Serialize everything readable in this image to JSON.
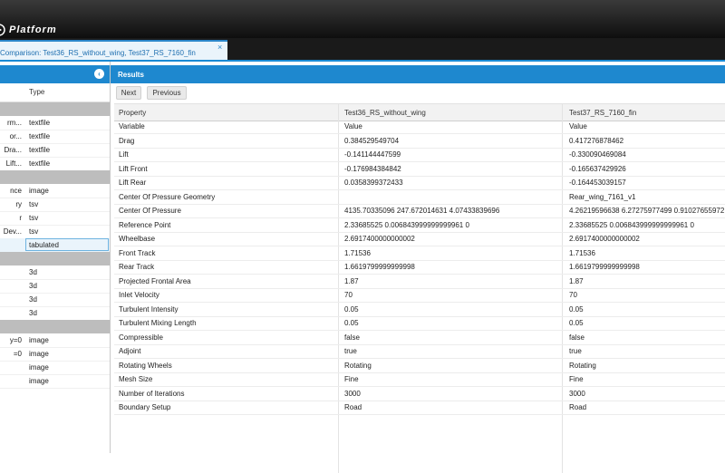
{
  "app": {
    "brand": "Platform"
  },
  "tab": {
    "label": "Comparison: Test36_RS_without_wing, Test37_RS_7160_fin",
    "close": "×"
  },
  "left_panel": {
    "toggle": "‹",
    "columns": [
      "",
      "Type"
    ],
    "groups": [
      {
        "rows": [
          {
            "name": "rm...",
            "type": "textfile"
          },
          {
            "name": "or...",
            "type": "textfile"
          },
          {
            "name": "Dra...",
            "type": "textfile"
          },
          {
            "name": "Lift...",
            "type": "textfile"
          }
        ]
      },
      {
        "rows": [
          {
            "name": "nce",
            "type": "image"
          },
          {
            "name": "ry",
            "type": "tsv"
          },
          {
            "name": "r",
            "type": "tsv"
          },
          {
            "name": "Dev...",
            "type": "tsv"
          },
          {
            "name": "",
            "type": "tabulated",
            "selected": true
          }
        ]
      },
      {
        "rows": [
          {
            "name": "",
            "type": "3d"
          },
          {
            "name": "",
            "type": "3d"
          },
          {
            "name": "",
            "type": "3d"
          },
          {
            "name": "",
            "type": "3d"
          }
        ]
      },
      {
        "rows": [
          {
            "name": "y=0",
            "type": "image"
          },
          {
            "name": "=0",
            "type": "image"
          },
          {
            "name": "",
            "type": "image"
          },
          {
            "name": "",
            "type": "image"
          }
        ]
      }
    ]
  },
  "results": {
    "title": "Results",
    "buttons": {
      "next": "Next",
      "previous": "Previous"
    },
    "columns": [
      "Property",
      "Test36_RS_without_wing",
      "Test37_RS_7160_fin"
    ],
    "rows": [
      [
        "Variable",
        "Value",
        "Value"
      ],
      [
        "Drag",
        "0.384529549704",
        "0.417276878462"
      ],
      [
        "Lift",
        "-0.141144447599",
        "-0.330090469084"
      ],
      [
        "Lift Front",
        "-0.176984384842",
        "-0.165637429926"
      ],
      [
        "Lift Rear",
        "0.0358399372433",
        "-0.164453039157"
      ],
      [
        "Center Of Pressure Geometry",
        "",
        "Rear_wing_7161_v1"
      ],
      [
        "Center Of Pressure",
        "4135.70335096 247.672014631 4.07433839696",
        "4.26219596638 6.27275977499 0.91027655972"
      ],
      [
        "Reference Point",
        "2.33685525 0.006843999999999961 0",
        "2.33685525 0.006843999999999961 0"
      ],
      [
        "Wheelbase",
        "2.6917400000000002",
        "2.6917400000000002"
      ],
      [
        "Front Track",
        "1.71536",
        "1.71536"
      ],
      [
        "Rear Track",
        "1.6619799999999998",
        "1.6619799999999998"
      ],
      [
        "Projected Frontal Area",
        "1.87",
        "1.87"
      ],
      [
        "Inlet Velocity",
        "70",
        "70"
      ],
      [
        "Turbulent Intensity",
        "0.05",
        "0.05"
      ],
      [
        "Turbulent Mixing Length",
        "0.05",
        "0.05"
      ],
      [
        "Compressible",
        "false",
        "false"
      ],
      [
        "Adjoint",
        "true",
        "true"
      ],
      [
        "Rotating Wheels",
        "Rotating",
        "Rotating"
      ],
      [
        "Mesh Size",
        "Fine",
        "Fine"
      ],
      [
        "Number of Iterations",
        "3000",
        "3000"
      ],
      [
        "Boundary Setup",
        "Road",
        "Road"
      ]
    ]
  },
  "colors": {
    "accent": "#1e88cf",
    "group_header": "#bdbdbd",
    "topbar": "#1a1a1a"
  }
}
